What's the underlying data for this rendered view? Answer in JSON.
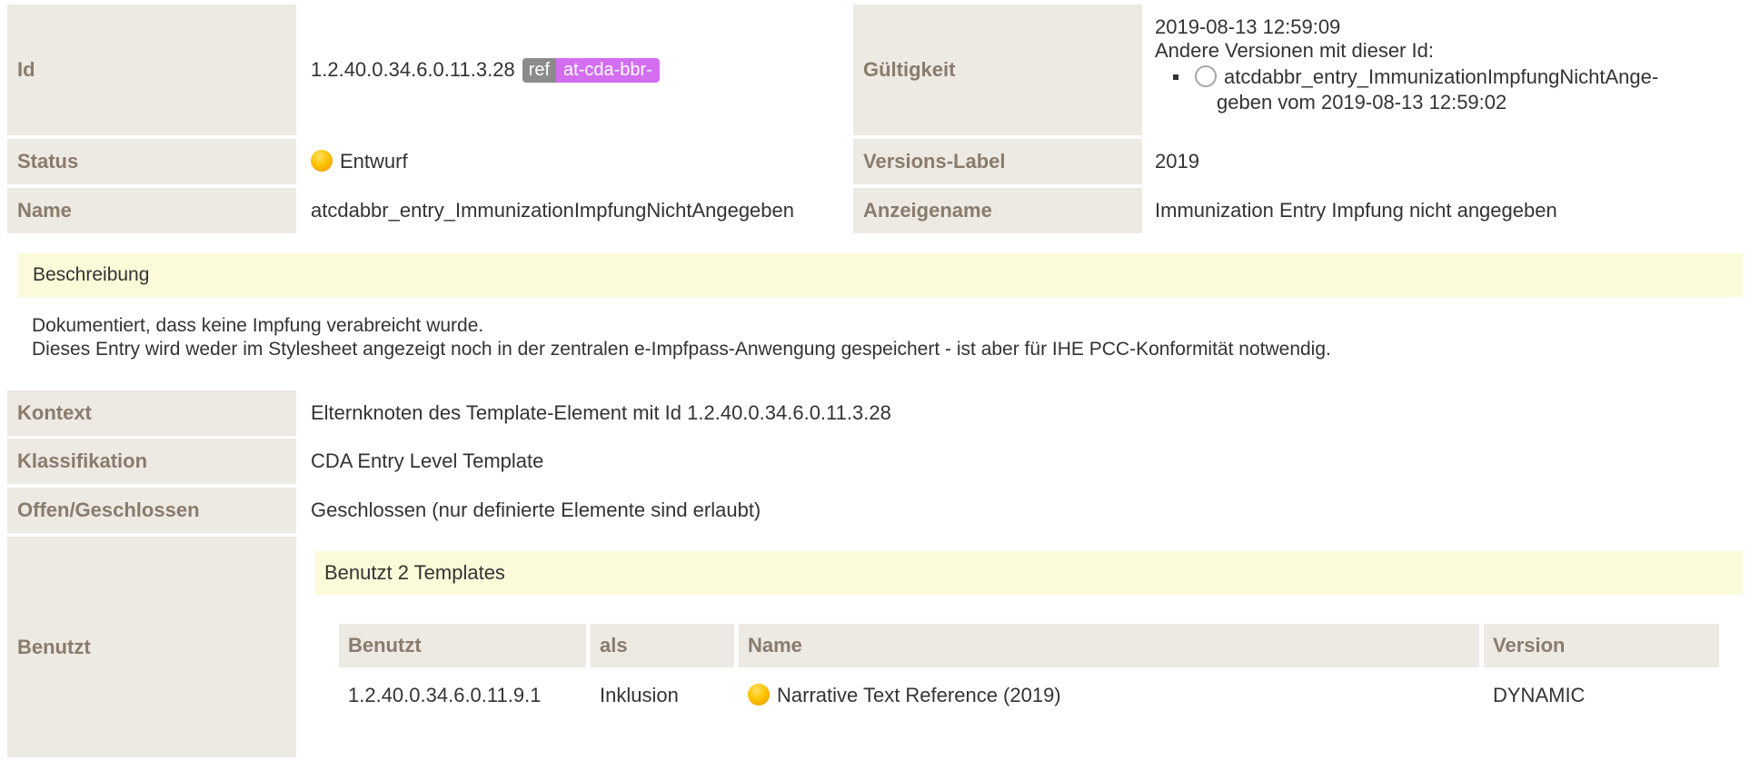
{
  "header": {
    "id_label": "Id",
    "id_value": "1.2.40.0.34.6.0.11.3.28",
    "ref_badge": "ref",
    "ref_prefix": "at-cda-bbr-",
    "validity_label": "Gültigkeit",
    "validity_date": "2019‑08‑13 12:59:09",
    "other_versions_text": "Andere Versionen mit dieser Id:",
    "other_version_line1": "atcdabbr_entry_ImmunizationImpfungNichtAnge-",
    "other_version_line2": "geben vom 2019‑08‑13 12:59:02",
    "status_label": "Status",
    "status_value": "Entwurf",
    "version_label_label": "Versions-Label",
    "version_label_value": "2019",
    "name_label": "Name",
    "name_value": "atcdabbr_entry_ImmunizationImpfungNichtAngegeben",
    "display_name_label": "Anzeigename",
    "display_name_value": "Immunization Entry Impfung nicht angegeben"
  },
  "description": {
    "title": "Beschreibung",
    "line1": "Dokumentiert, dass keine Impfung verabreicht wurde.",
    "line2": "Dieses Entry wird weder im Stylesheet angezeigt  noch in der zentralen e-Impfpass-Anwengung gespeichert  - ist aber für IHE PCC-Konformität notwendig."
  },
  "details": {
    "context_label": "Kontext",
    "context_value": "Elternknoten des Template-Element mit Id 1.2.40.0.34.6.0.11.3.28",
    "classification_label": "Klassifikation",
    "classification_value": "CDA Entry Level Template",
    "open_closed_label": "Offen/Geschlossen",
    "open_closed_value": "Geschlossen (nur definierte Elemente sind erlaubt)",
    "uses_label": "Benutzt"
  },
  "uses": {
    "title": "Benutzt 2 Templates",
    "columns": [
      "Benutzt",
      "als",
      "Name",
      "Version"
    ],
    "rows": [
      {
        "id": "1.2.40.0.34.6.0.11.9.1",
        "as": "Inklusion",
        "name": "Narrative Text Reference (2019)",
        "version": "DYNAMIC"
      }
    ]
  },
  "colors": {
    "label_bg": "#ede9e3",
    "label_text": "#8a7b6b",
    "highlight_bg": "#fbfbd9",
    "prefix_badge": "#d36ef0",
    "status_draft": "#ffc300"
  }
}
